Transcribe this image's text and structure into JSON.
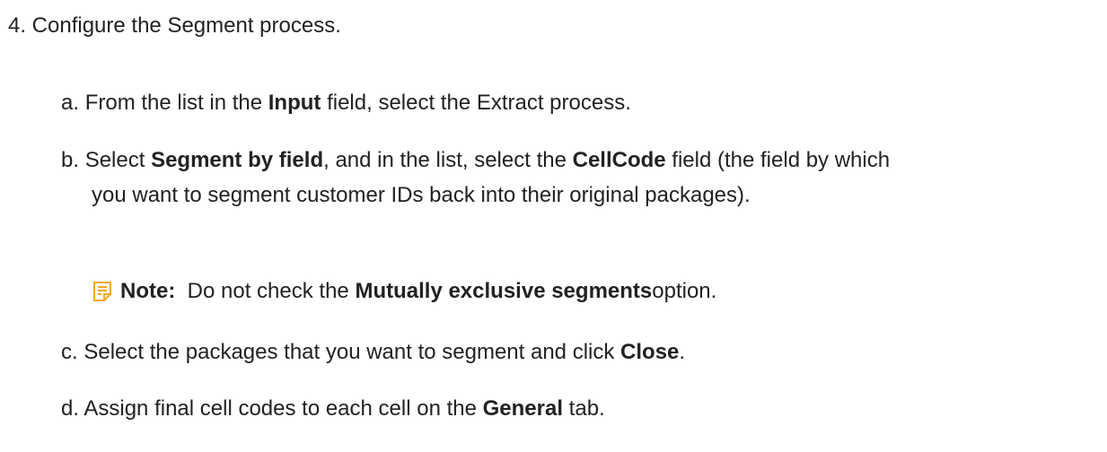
{
  "step": {
    "title": "4. Configure the Segment process."
  },
  "substeps": {
    "a": {
      "marker": "a.",
      "t1": "From the list in the ",
      "b1": "Input",
      "t2": " field, select the Extract process."
    },
    "b": {
      "marker": "b.",
      "t1": "Select ",
      "b1": "Segment by field",
      "t2": ", and in the list, select the ",
      "b2": "CellCode",
      "t3": " field (the field by which",
      "t4": "you want to segment customer IDs back into their original packages)."
    },
    "c": {
      "marker": "c.",
      "t1": "Select the packages that you want to segment and click ",
      "b1": "Close",
      "t2": "."
    },
    "d": {
      "marker": "d.",
      "t1": "Assign final cell codes to each cell on the ",
      "b1": "General",
      "t2": " tab."
    }
  },
  "note": {
    "icon": "note-icon",
    "label": "Note:",
    "t1": "Do not check the ",
    "b1": "Mutually exclusive segments",
    "t2": " option.",
    "icon_color": "#f5a623"
  }
}
